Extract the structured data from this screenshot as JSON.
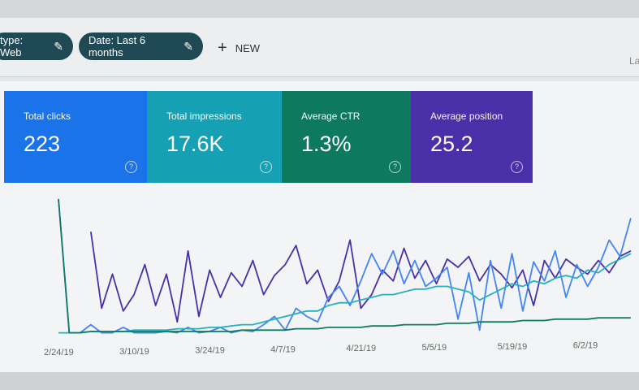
{
  "filters": {
    "chips": [
      {
        "label": "type: Web",
        "icon": "pencil-icon"
      },
      {
        "label": "Date: Last 6 months",
        "icon": "pencil-icon"
      }
    ],
    "new_label": "NEW",
    "new_icon": "plus-icon",
    "cut_text": "La"
  },
  "metrics": [
    {
      "label": "Total clicks",
      "value": "223",
      "color": "#1a73e8",
      "help": "?"
    },
    {
      "label": "Total impressions",
      "value": "17.6K",
      "color": "#15a0b3",
      "help": "?"
    },
    {
      "label": "Average CTR",
      "value": "1.3%",
      "color": "#0d7a60",
      "help": "?"
    },
    {
      "label": "Average position",
      "value": "25.2",
      "color": "#4a2fa8",
      "help": "?"
    }
  ],
  "chart_data": {
    "type": "line",
    "xticks": [
      {
        "index": 0,
        "label": "2/24/19"
      },
      {
        "index": 7,
        "label": "3/10/19"
      },
      {
        "index": 14,
        "label": "3/24/19"
      },
      {
        "index": 21,
        "label": "4/7/19"
      },
      {
        "index": 28,
        "label": "4/21/19"
      },
      {
        "index": 35,
        "label": "5/5/19"
      },
      {
        "index": 42,
        "label": "5/19/19"
      },
      {
        "index": 49,
        "label": "6/2/19"
      }
    ],
    "ylim": [
      0,
      100
    ],
    "grid": false,
    "series": [
      {
        "color": "#4a2fa8",
        "values": [
          null,
          null,
          null,
          76,
          20,
          45,
          18,
          30,
          52,
          22,
          45,
          10,
          62,
          14,
          48,
          28,
          46,
          36,
          55,
          30,
          44,
          52,
          66,
          38,
          48,
          25,
          40,
          70,
          20,
          30,
          48,
          40,
          64,
          42,
          55,
          38,
          56,
          50,
          58,
          40,
          52,
          45,
          35,
          48,
          22,
          55,
          42,
          56,
          50,
          45,
          55,
          46,
          58,
          62
        ]
      },
      {
        "color": "#4285f4",
        "values": [
          100,
          2,
          2,
          8,
          2,
          2,
          6,
          2,
          2,
          2,
          3,
          2,
          6,
          2,
          3,
          6,
          2,
          4,
          3,
          8,
          14,
          4,
          20,
          14,
          10,
          28,
          36,
          22,
          40,
          60,
          45,
          62,
          38,
          55,
          36,
          42,
          50,
          12,
          46,
          4,
          55,
          20,
          60,
          18,
          54,
          40,
          62,
          28,
          52,
          36,
          50,
          70,
          58,
          86
        ]
      },
      {
        "color": "#26b0bf",
        "values": [
          2,
          2,
          2,
          3,
          3,
          3,
          3,
          4,
          4,
          4,
          4,
          5,
          5,
          5,
          6,
          6,
          7,
          8,
          8,
          10,
          12,
          14,
          16,
          18,
          18,
          22,
          24,
          24,
          26,
          28,
          30,
          30,
          32,
          34,
          34,
          36,
          36,
          34,
          32,
          26,
          30,
          34,
          38,
          36,
          40,
          38,
          42,
          44,
          42,
          48,
          46,
          52,
          56,
          60
        ]
      },
      {
        "color": "#0f7b63",
        "values": [
          100,
          2,
          2,
          3,
          3,
          3,
          3,
          3,
          3,
          3,
          3,
          3,
          3,
          3,
          3,
          3,
          3,
          4,
          4,
          4,
          4,
          4,
          5,
          5,
          5,
          6,
          6,
          6,
          6,
          7,
          7,
          7,
          8,
          8,
          8,
          8,
          9,
          9,
          9,
          10,
          10,
          10,
          10,
          11,
          11,
          11,
          12,
          12,
          12,
          12,
          13,
          13,
          13,
          13
        ]
      }
    ]
  }
}
